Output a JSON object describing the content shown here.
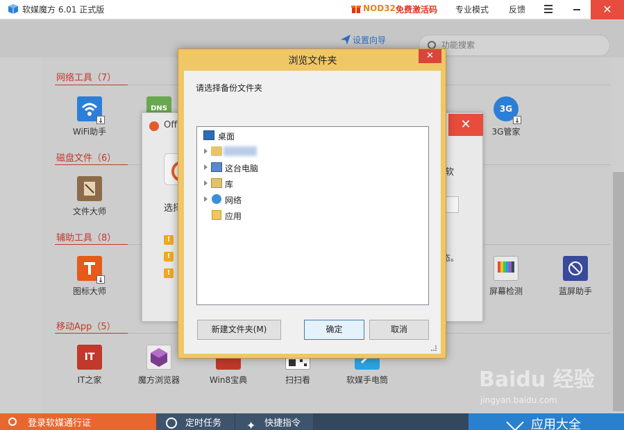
{
  "titlebar": {
    "app_title": "软媒魔方 6.01 正式版",
    "promo_nod": "NOD32",
    "promo_free": "免费激活码",
    "pro_mode": "专业模式",
    "feedback": "反馈",
    "close_symbol": "✕",
    "icons": {
      "logo": "cube-logo-icon",
      "gift": "gift-icon",
      "menu": "hamburger-menu-icon",
      "minimize": "minimize-icon"
    }
  },
  "toolbar": {
    "setup_guide": "设置向导",
    "search": {
      "placeholder": "功能搜索"
    }
  },
  "sections": [
    {
      "title": "网络工具（7）",
      "items": [
        {
          "label": "WiFi助手",
          "icon": "wifi-icon",
          "color": "#2b7fd8"
        },
        {
          "label": "DNS",
          "icon": "dns-icon",
          "color": "#6aa84f"
        },
        {
          "label": "3G管家",
          "icon": "3g-icon",
          "color": "#2b7fd8"
        }
      ]
    },
    {
      "title": "磁盘文件（6）",
      "items": [
        {
          "label": "文件大师",
          "icon": "file-master-icon",
          "color": "#8b6b4a"
        }
      ]
    },
    {
      "title": "辅助工具（8）",
      "items": [
        {
          "label": "图标大师",
          "icon": "icon-master-icon",
          "color": "#e65a1a"
        },
        {
          "label": "屏幕检测",
          "icon": "screen-test-icon",
          "color": "#7a7a7a"
        },
        {
          "label": "蓝屏助手",
          "icon": "bluescreen-icon",
          "color": "#3a4a9a"
        }
      ]
    },
    {
      "title": "移动App（5）",
      "items": [
        {
          "label": "IT之家",
          "icon": "ithome-icon",
          "color": "#c0392b"
        },
        {
          "label": "魔方浏览器",
          "icon": "browser-icon",
          "color": "#7b3c8e"
        },
        {
          "label": "Win8宝典",
          "icon": "win8-book-icon",
          "color": "#c0392b"
        },
        {
          "label": "扫扫看",
          "icon": "qr-scan-icon",
          "color": "#444444"
        },
        {
          "label": "软媒手电筒",
          "icon": "flashlight-icon",
          "color": "#2aa3e0"
        }
      ]
    }
  ],
  "bottombar": {
    "login": "登录软媒通行证",
    "timer": "定时任务",
    "shortcut": "快捷指令",
    "all_apps": "应用大全"
  },
  "bg_dialog": {
    "title": "Offi",
    "close_symbol": "✕",
    "choose": "选择",
    "warn_mark": "!",
    "soft": "软",
    "state_text": "状态。",
    "source_text": "源。"
  },
  "browse_dialog": {
    "title": "浏览文件夹",
    "close_symbol": "✕",
    "prompt": "请选择备份文件夹",
    "tree": [
      {
        "label": "桌面",
        "icon": "desktop-icon"
      },
      {
        "label": "",
        "icon": "user-folder-icon"
      },
      {
        "label": "这台电脑",
        "icon": "computer-icon"
      },
      {
        "label": "库",
        "icon": "library-icon"
      },
      {
        "label": "网络",
        "icon": "network-icon"
      },
      {
        "label": "应用",
        "icon": "app-folder-icon"
      }
    ],
    "new_folder": "新建文件夹(M)",
    "ok": "确定",
    "cancel": "取消"
  },
  "watermark": {
    "text": "Baidu 经验",
    "url": "jingyan.baidu.com"
  },
  "colors": {
    "accent_red": "#c0392b",
    "close_red": "#e74c3c",
    "dialog_gold": "#f0c766",
    "bottom_blue": "#2980cf",
    "bottom_orange": "#e8672f"
  }
}
